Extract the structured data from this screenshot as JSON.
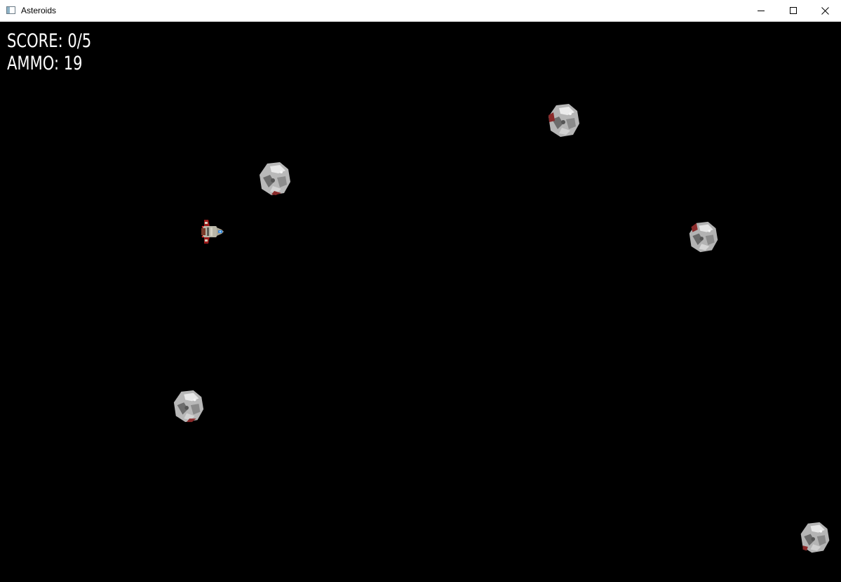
{
  "window": {
    "title": "Asteroids",
    "icon": "app-window-icon",
    "controls": {
      "minimize_icon": "minimize-icon",
      "maximize_icon": "maximize-icon",
      "close_icon": "close-icon"
    }
  },
  "hud": {
    "score_text": "SCORE: 0/5",
    "ammo_text": "AMMO: 19"
  },
  "game": {
    "background_color": "#000000",
    "player_ship": "spaceship-icon",
    "asteroid_sprite": "asteroid-icon"
  }
}
